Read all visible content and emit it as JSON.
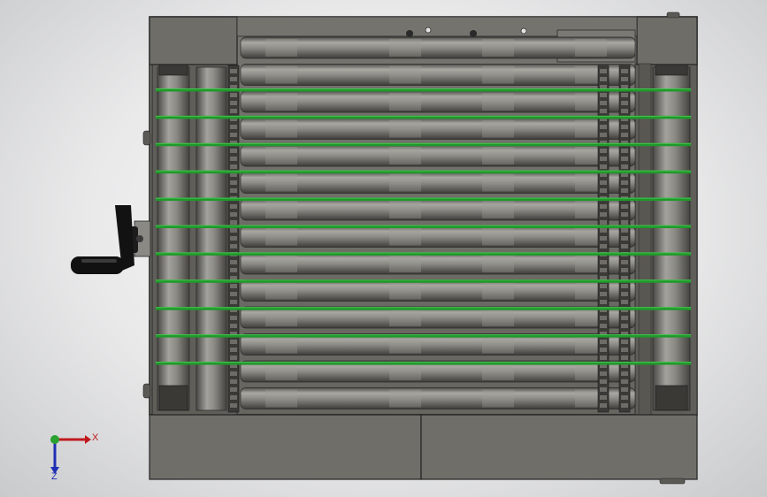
{
  "viewport": {
    "background_top": "#fbfbfb",
    "background_bottom": "#c9cacc"
  },
  "model": {
    "frame_color": "#6f6e69",
    "frame_edge": "#222222",
    "roller_light": "#a7a6a1",
    "roller_mid": "#7d7c77",
    "roller_dark": "#4a4946",
    "belt_color": "#1f9a2a",
    "belt_highlight": "#47c24f",
    "handle_color": "#111111",
    "roller_count": 14,
    "belt_count": 11
  },
  "triad": {
    "x_label": "X",
    "z_label": "Z",
    "x_color": "#c0191d",
    "y_color": "#2aa130",
    "z_color": "#1f2fb4"
  }
}
